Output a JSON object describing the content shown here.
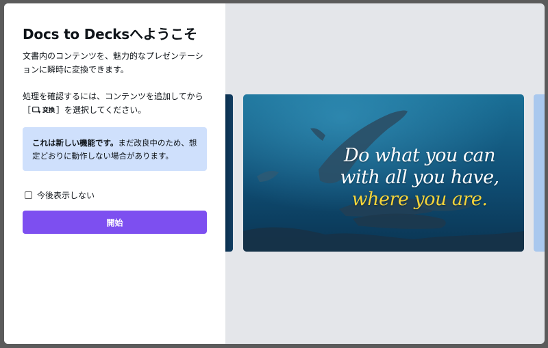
{
  "dialog": {
    "title": "Docs to Decksへようこそ",
    "description": "文書内のコンテンツを、魅力的なプレゼンテーションに瞬時に変換できます。",
    "instruction_before": "処理を確認するには、コンテンツを追加してから［",
    "instruction_button": "変換",
    "instruction_after": "］を選択してください。",
    "notice_strong": "これは新しい機能です。",
    "notice_rest": "まだ改良中のため、想定どおりに動作しない場合があります。",
    "checkbox_label": "今後表示しない",
    "checkbox_checked": false,
    "start_label": "開始"
  },
  "preview": {
    "quote_line1": "Do what you can",
    "quote_line2": "with all you have,",
    "quote_line3": "where you are."
  },
  "colors": {
    "accent": "#7d4ff0",
    "notice_bg": "#cfe0fc",
    "quote_highlight": "#f5d43a"
  }
}
